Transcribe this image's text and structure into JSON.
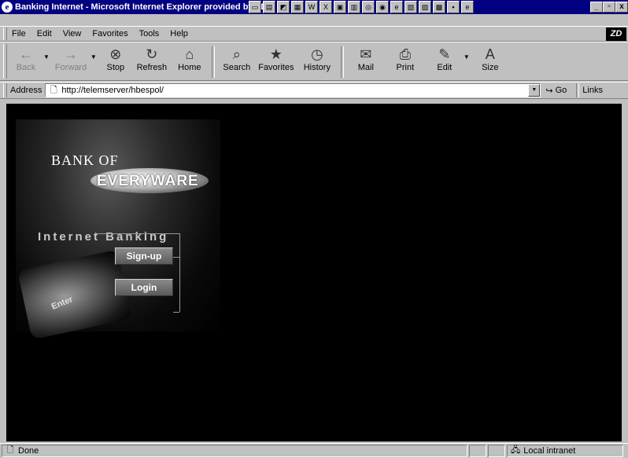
{
  "window": {
    "title": "Banking Internet - Microsoft Internet Explorer provided by ZDNet",
    "title_visible": "Banking Internet - Microsoft Internet Explorer provided by ZD",
    "controls": [
      "_",
      "▫",
      "x"
    ],
    "taskbar_icons": [
      "▭",
      "▤",
      "◩",
      "▦",
      "W",
      "X",
      "▣",
      "▥",
      "◎",
      "◉",
      "e",
      "▧",
      "▨",
      "▩",
      "▪",
      "e"
    ]
  },
  "menubar": {
    "items": [
      "File",
      "Edit",
      "View",
      "Favorites",
      "Tools",
      "Help"
    ],
    "logo": "ZD"
  },
  "toolbar": {
    "buttons": [
      {
        "label": "Back",
        "icon": "←",
        "disabled": true
      },
      {
        "label": "Forward",
        "icon": "→",
        "disabled": true
      },
      {
        "label": "Stop",
        "icon": "⊗"
      },
      {
        "label": "Refresh",
        "icon": "↻"
      },
      {
        "label": "Home",
        "icon": "⌂"
      },
      {
        "label": "Search",
        "icon": "⌕"
      },
      {
        "label": "Favorites",
        "icon": "★"
      },
      {
        "label": "History",
        "icon": "◷"
      },
      {
        "label": "Mail",
        "icon": "✉"
      },
      {
        "label": "Print",
        "icon": "⎙"
      },
      {
        "label": "Edit",
        "icon": "✎"
      },
      {
        "label": "Size",
        "icon": "A"
      }
    ]
  },
  "addressbar": {
    "label": "Address",
    "url": "http://telemserver/hbespol/",
    "go_label": "Go",
    "links_label": "Links"
  },
  "page": {
    "bank_of": "BANK OF",
    "brand": "EVERYWARE",
    "section": "Internet Banking",
    "keyboard_key": "Enter",
    "signup": "Sign-up",
    "login": "Login"
  },
  "statusbar": {
    "text": "Done",
    "zone": "Local intranet"
  },
  "colors": {
    "titlebar": "#000080",
    "chrome": "#c0c0c0",
    "page_bg": "#000000"
  }
}
